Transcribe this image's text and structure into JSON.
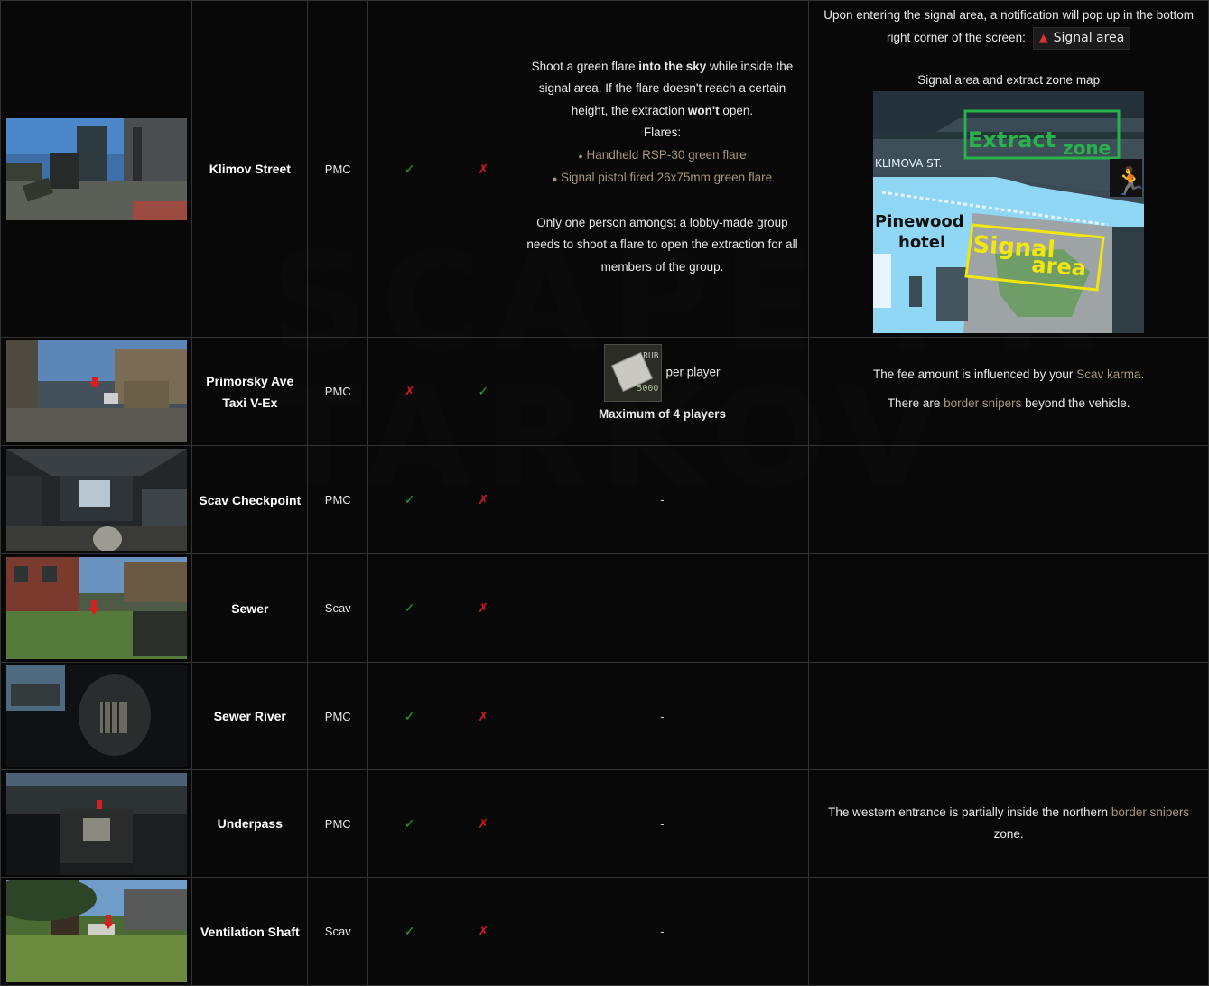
{
  "rows": [
    {
      "name": "Klimov Street",
      "side": "PMC",
      "col3": "✓",
      "col4": "✗",
      "requirements": {
        "line1": "Shoot a green flare ",
        "line1_bold": "into the sky",
        "line1b": " while inside the signal area. If the flare doesn't reach a certain height, the extraction ",
        "wont": "won't",
        "line1c": " open.",
        "flares_title": "Flares:",
        "flares": [
          "Handheld RSP-30 green flare",
          "Signal pistol fired 26x75mm green flare"
        ],
        "group_note": "Only one person amongst a lobby-made group needs to shoot a flare to open the extraction for all members of the group."
      },
      "notes": {
        "popup_text": "Upon entering the signal area, a notification will pop up in the bottom right corner of the screen:",
        "badge": "Signal area",
        "map_caption": "Signal area and extract zone map",
        "map_labels": {
          "extract": "Extract",
          "zone": "zone",
          "street": "KLIMOVA ST.",
          "hotel1": "Pinewood",
          "hotel2": "hotel",
          "signal": "Signal",
          "area": "area"
        }
      }
    },
    {
      "name": "Primorsky Ave Taxi V-Ex",
      "side": "PMC",
      "col3": "✗",
      "col4": "✓",
      "requirements": {
        "rub_label": "RUB",
        "rub_amount": "5000",
        "per_player": "per player",
        "max_players": "Maximum of 4 players"
      },
      "notes": {
        "karma_pre": "The fee amount is influenced by your ",
        "karma_link": "Scav karma",
        "karma_post": ".",
        "snipers_pre": "There are ",
        "snipers_link": "border snipers",
        "snipers_post": " beyond the vehicle."
      }
    },
    {
      "name": "Scav Checkpoint",
      "side": "PMC",
      "col3": "✓",
      "col4": "✗",
      "requirements": "-",
      "notes": ""
    },
    {
      "name": "Sewer",
      "side": "Scav",
      "col3": "✓",
      "col4": "✗",
      "requirements": "-",
      "notes": ""
    },
    {
      "name": "Sewer River",
      "side": "PMC",
      "col3": "✓",
      "col4": "✗",
      "requirements": "-",
      "notes": ""
    },
    {
      "name": "Underpass",
      "side": "PMC",
      "col3": "✓",
      "col4": "✗",
      "requirements": "-",
      "notes": {
        "pre": "The western entrance is partially inside the northern ",
        "link": "border snipers",
        "post": " zone."
      }
    },
    {
      "name": "Ventilation Shaft",
      "side": "Scav",
      "col3": "✓",
      "col4": "✗",
      "requirements": "-",
      "notes": ""
    }
  ],
  "colors": {
    "check": "#2ea02e",
    "cross": "#d31c1c",
    "link": "#a89575",
    "map_extract": "#27b24a",
    "map_signal": "#f2e60f"
  }
}
